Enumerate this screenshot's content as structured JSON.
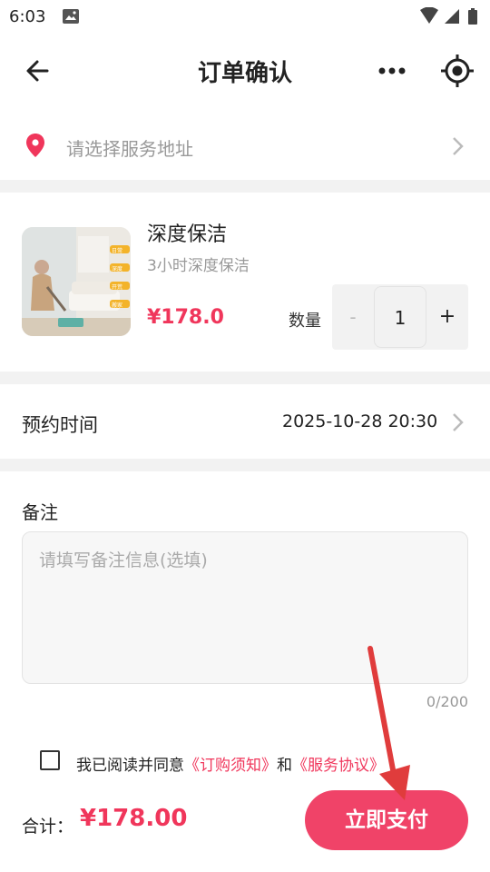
{
  "status": {
    "time": "6:03"
  },
  "header": {
    "title": "订单确认"
  },
  "address": {
    "placeholder": "请选择服务地址"
  },
  "product": {
    "name": "深度保洁",
    "subtitle": "3小时深度保洁",
    "price": "¥178.0",
    "qty_label": "数量",
    "minus": "-",
    "qty": "1",
    "plus": "+",
    "thumb_tags": [
      "日常",
      "深度",
      "开荒",
      "搬家"
    ]
  },
  "booking": {
    "label": "预约时间",
    "value": "2025-10-28 20:30"
  },
  "remarks": {
    "label": "备注",
    "placeholder": "请填写备注信息(选填)",
    "count": "0/200"
  },
  "agreement": {
    "prefix": "我已阅读并同意",
    "link1": "《订购须知》",
    "mid": "和",
    "link2": "《服务协议》"
  },
  "footer": {
    "total_label": "合计：",
    "total_amount": "¥178.00",
    "pay_label": "立即支付"
  },
  "colors": {
    "accent": "#f0365b",
    "pay_button": "#f04368",
    "annotation_arrow": "#e03c3c"
  }
}
